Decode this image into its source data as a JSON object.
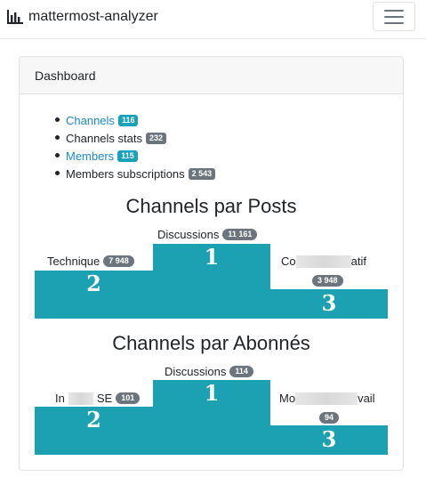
{
  "navbar": {
    "brand": "mattermost-analyzer",
    "brand_icon": "bar-chart-icon",
    "toggler_icon": "hamburger-menu-icon"
  },
  "card": {
    "header": "Dashboard",
    "menu": [
      {
        "label": "Channels",
        "badge": "116",
        "link": true
      },
      {
        "label": "Channels stats",
        "badge": "232",
        "link": false
      },
      {
        "label": "Members",
        "badge": "115",
        "link": true
      },
      {
        "label": "Members subscriptions",
        "badge": "2 543",
        "link": false
      }
    ]
  },
  "posts": {
    "title": "Channels par Posts",
    "first": {
      "rank": "1",
      "label": "Discussions",
      "count": "11 161"
    },
    "second": {
      "rank": "2",
      "label": "Technique",
      "count": "7 948"
    },
    "third": {
      "rank": "3",
      "label_start": "Co",
      "label_end": "atif",
      "count": "3 948"
    }
  },
  "subs": {
    "title": "Channels par Abonnés",
    "first": {
      "rank": "1",
      "label": "Discussions",
      "count": "114"
    },
    "second": {
      "rank": "2",
      "label_start": "In",
      "label_end": "SE",
      "count": "101"
    },
    "third": {
      "rank": "3",
      "label_start": "Mo",
      "label_end": "vail",
      "count": "94"
    }
  },
  "colors": {
    "podium": "#1ba1b2",
    "link": "#1a8ad0",
    "badge_info": "#17a2b8",
    "badge_dark": "#6c757d"
  }
}
